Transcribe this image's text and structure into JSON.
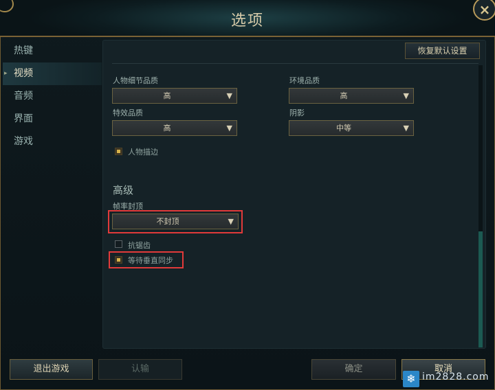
{
  "window": {
    "title": "选项",
    "close_icon": "×"
  },
  "sidebar": {
    "items": [
      {
        "label": "热键",
        "active": false
      },
      {
        "label": "视频",
        "active": true
      },
      {
        "label": "音频",
        "active": false
      },
      {
        "label": "界面",
        "active": false
      },
      {
        "label": "游戏",
        "active": false
      }
    ],
    "active_marker": "▸"
  },
  "video": {
    "restore_defaults_label": "恢复默认设置",
    "character_quality": {
      "label": "人物细节品质",
      "value": "高"
    },
    "environment_quality": {
      "label": "环境品质",
      "value": "高"
    },
    "effects_quality": {
      "label": "特效品质",
      "value": "高"
    },
    "shadows": {
      "label": "阴影",
      "value": "中等"
    },
    "character_outline": {
      "label": "人物描边",
      "checked": true
    },
    "dropdown_arrow": "▼",
    "advanced": {
      "title": "高级",
      "frame_rate_cap": {
        "label": "帧率封顶",
        "value": "不封顶"
      },
      "anti_aliasing": {
        "label": "抗锯齿",
        "checked": false
      },
      "vsync": {
        "label": "等待垂直同步",
        "checked": true
      }
    }
  },
  "footer": {
    "exit_game_label": "退出游戏",
    "surrender_label": "认输",
    "ok_label": "确定",
    "cancel_label": "取消"
  },
  "watermark": {
    "text": "im2828.com",
    "icon": "snowflake-icon",
    "icon_glyph": "❄"
  },
  "colors": {
    "accent_gold": "#b89a5a",
    "highlight_red": "#e23a3a",
    "scroll_thumb": "#1c5a52"
  }
}
